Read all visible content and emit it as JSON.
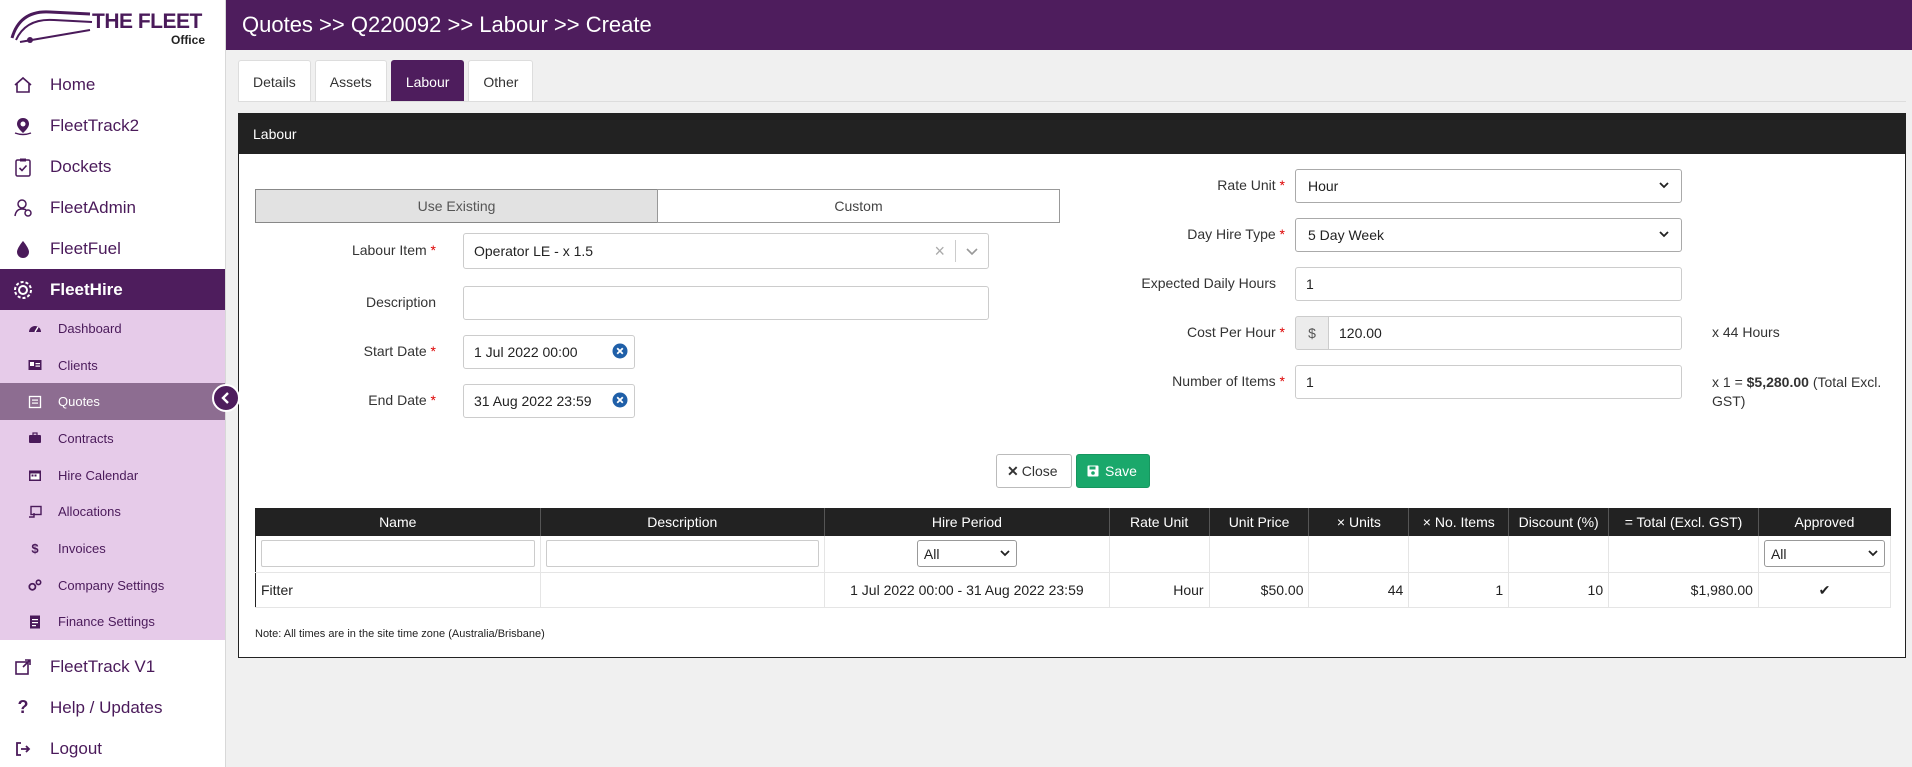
{
  "brand": {
    "name": "THE FLEET",
    "sub": "Office"
  },
  "header": {
    "breadcrumb": "Quotes >> Q220092 >> Labour >> Create"
  },
  "sidebar": {
    "items": [
      {
        "label": "Home",
        "icon": "home-icon"
      },
      {
        "label": "FleetTrack2",
        "icon": "map-pin-icon"
      },
      {
        "label": "Dockets",
        "icon": "clipboard-check-icon"
      },
      {
        "label": "FleetAdmin",
        "icon": "user-gear-icon"
      },
      {
        "label": "FleetFuel",
        "icon": "fuel-drop-icon"
      },
      {
        "label": "FleetHire",
        "icon": "gears-icon"
      }
    ],
    "subitems": [
      {
        "label": "Dashboard",
        "icon": "gauge-icon"
      },
      {
        "label": "Clients",
        "icon": "id-card-icon"
      },
      {
        "label": "Quotes",
        "icon": "quote-icon"
      },
      {
        "label": "Contracts",
        "icon": "briefcase-icon"
      },
      {
        "label": "Hire Calendar",
        "icon": "calendar-icon"
      },
      {
        "label": "Allocations",
        "icon": "allocation-icon"
      },
      {
        "label": "Invoices",
        "icon": "dollar-icon"
      },
      {
        "label": "Company Settings",
        "icon": "cogs-icon"
      },
      {
        "label": "Finance Settings",
        "icon": "document-icon"
      }
    ],
    "bottom": [
      {
        "label": "FleetTrack V1",
        "icon": "external-link-icon"
      },
      {
        "label": "Help / Updates",
        "icon": "question-icon"
      },
      {
        "label": "Logout",
        "icon": "logout-icon"
      }
    ]
  },
  "tabs": [
    "Details",
    "Assets",
    "Labour",
    "Other"
  ],
  "panel": {
    "title": "Labour"
  },
  "form": {
    "mode_existing": "Use Existing",
    "mode_custom": "Custom",
    "labour_item_label": "Labour Item",
    "labour_item_value": "Operator LE - x 1.5",
    "description_label": "Description",
    "description_value": "",
    "start_date_label": "Start Date",
    "start_date_value": "1 Jul 2022 00:00",
    "end_date_label": "End Date",
    "end_date_value": "31 Aug 2022 23:59",
    "rate_unit_label": "Rate Unit",
    "rate_unit_value": "Hour",
    "day_hire_type_label": "Day Hire Type",
    "day_hire_type_value": "5 Day Week",
    "expected_daily_hours_label": "Expected Daily Hours",
    "expected_daily_hours_value": "1",
    "cost_per_hour_label": "Cost Per Hour",
    "currency_symbol": "$",
    "cost_per_hour_value": "120.00",
    "hours_hint": "x 44 Hours",
    "number_of_items_label": "Number of Items",
    "number_of_items_value": "1",
    "total_prefix": "x 1 =",
    "total_value": "$5,280.00",
    "total_suffix": "(Total Excl. GST)",
    "required_mark": "*",
    "close_label": "Close",
    "save_label": "Save"
  },
  "table": {
    "columns": [
      "Name",
      "Description",
      "Hire Period",
      "Rate Unit",
      "Unit Price",
      "× Units",
      "× No. Items",
      "Discount (%)",
      "= Total (Excl. GST)",
      "Approved"
    ],
    "hire_period_filter": "All",
    "approved_filter": "All",
    "rows": [
      {
        "name": "Fitter",
        "description": "",
        "hire_period": "1 Jul 2022 00:00 - 31 Aug 2022 23:59",
        "rate_unit": "Hour",
        "unit_price": "$50.00",
        "units": "44",
        "no_items": "1",
        "discount": "10",
        "total": "$1,980.00",
        "approved": "✔"
      }
    ]
  },
  "note": "Note: All times are in the site time zone (Australia/Brisbane)",
  "colors": {
    "brand": "#4e1d5d",
    "subnav": "#e6cbe9",
    "save": "#1aa86b",
    "header_dark": "#222222"
  }
}
